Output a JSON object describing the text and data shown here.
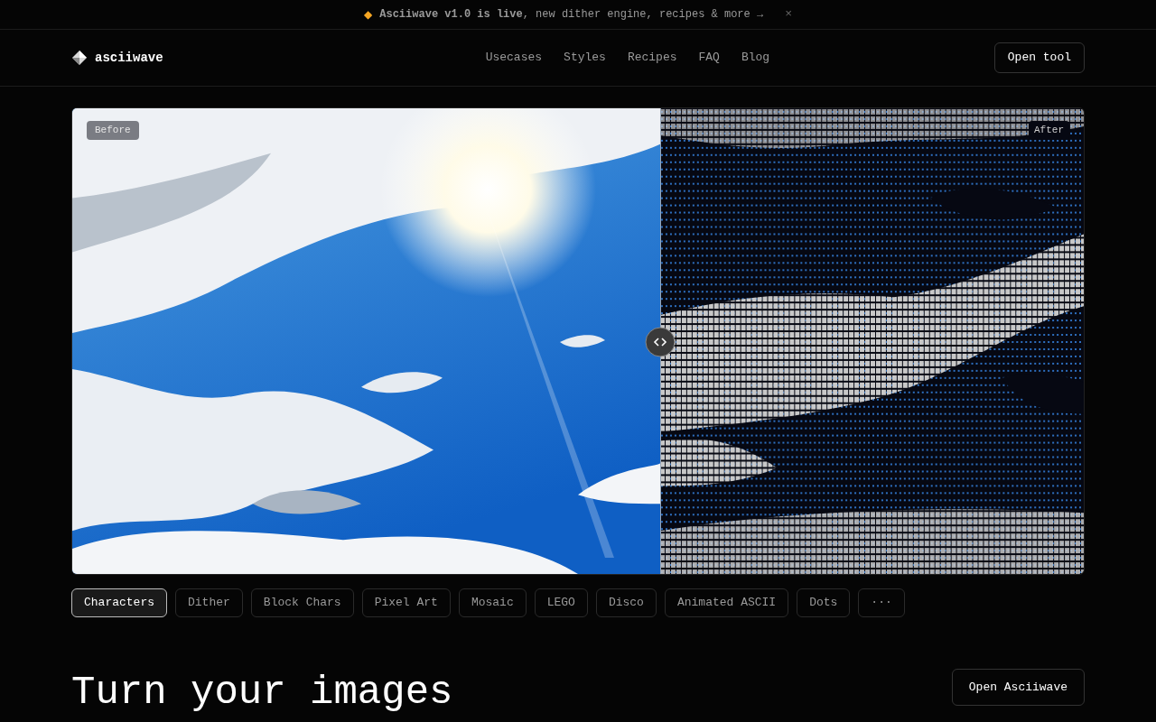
{
  "announcement": {
    "icon": "◆",
    "text": "**Asciiwave v1.0 is live**, new dither engine, recipes & more →",
    "close": "×"
  },
  "nav": {
    "brand": "asciiwave",
    "links": [
      "Usecases",
      "Styles",
      "Recipes",
      "FAQ",
      "Blog"
    ],
    "button": "Open tool"
  },
  "comparison": {
    "before_label": "Before",
    "after_label": "After"
  },
  "styles": [
    {
      "label": "Characters",
      "selected": true
    },
    {
      "label": "Dither",
      "selected": false
    },
    {
      "label": "Block Chars",
      "selected": false
    },
    {
      "label": "Pixel Art",
      "selected": false
    },
    {
      "label": "Mosaic",
      "selected": false
    },
    {
      "label": "LEGO",
      "selected": false
    },
    {
      "label": "Disco",
      "selected": false
    },
    {
      "label": "Animated ASCII",
      "selected": false
    },
    {
      "label": "Dots",
      "selected": false
    },
    {
      "label": "···",
      "selected": false
    }
  ],
  "hero": {
    "heading": "Turn your images",
    "button": "Open Asciiwave"
  }
}
